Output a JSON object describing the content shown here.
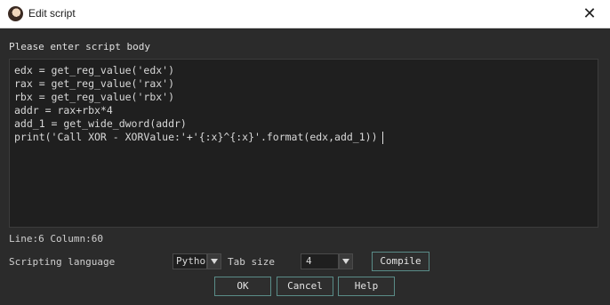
{
  "window": {
    "title": "Edit script",
    "close_glyph": "✕",
    "app_icon": "app-icon"
  },
  "prompt": "Please enter script body",
  "editor": {
    "lines": [
      "edx = get_reg_value('edx')",
      "rax = get_reg_value('rax')",
      "rbx = get_reg_value('rbx')",
      "addr = rax+rbx*4",
      "add_1 = get_wide_dword(addr)",
      "print('Call XOR - XORValue:'+'{:x}^{:x}'.format(edx,add_1))"
    ]
  },
  "status": {
    "text": "Line:6  Column:60"
  },
  "scripting": {
    "label": "Scripting language",
    "language_value": "Python",
    "tab_size_label": "Tab size",
    "tab_size_value": "4",
    "compile_label": "Compile"
  },
  "buttons": {
    "ok": "OK",
    "cancel": "Cancel",
    "help": "Help"
  },
  "colors": {
    "background": "#2b2b2b",
    "editor_background": "#1f1f1f",
    "button_border": "#5a8c88",
    "titlebar": "#ffffff"
  }
}
